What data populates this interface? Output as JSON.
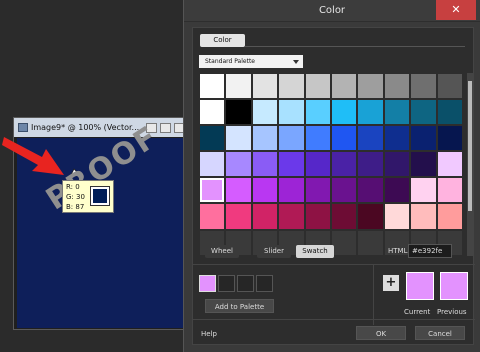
{
  "document_window": {
    "title": "Image9* @ 100% (Vector...",
    "watermark": "PROOF",
    "readout": {
      "r": "R: 0",
      "g": "G: 30",
      "b": "B: 87"
    },
    "sample_color": "#001e57"
  },
  "dialog": {
    "title": "Color",
    "close_icon": "close-icon",
    "tab_label": "Color",
    "palette_select": "Standard Palette",
    "palette_colors": [
      [
        "#ffffff",
        "#f2f2f2",
        "#e3e3e3",
        "#d5d5d5",
        "#c6c6c6",
        "#b3b3b3",
        "#9e9e9e",
        "#8a8a8a",
        "#6f6f6f",
        "#555555"
      ],
      [
        "#ffffff",
        "#000000",
        "#c6eaff",
        "#a8e1ff",
        "#59cfff",
        "#1fbef7",
        "#19a2d6",
        "#137fa6",
        "#0e6582",
        "#0a5069"
      ],
      [
        "#033a55",
        "#d4e4ff",
        "#a6c5ff",
        "#7aa6ff",
        "#407cff",
        "#1f56f2",
        "#1a44c0",
        "#0f2e8f",
        "#0a2170",
        "#06164f"
      ],
      [
        "#d6d6ff",
        "#a788ff",
        "#8a5cf5",
        "#6b39ea",
        "#5627c9",
        "#4a22a6",
        "#3e1d88",
        "#31176a",
        "#230f4c",
        "#f1c9ff"
      ],
      [
        "#e392fe",
        "#d55cff",
        "#b937f2",
        "#9d24d6",
        "#8118b0",
        "#6a128f",
        "#560e73",
        "#3d0a53",
        "#ffd2f0",
        "#ffb3df"
      ],
      [
        "#ff6f9e",
        "#f03a7f",
        "#d12366",
        "#b01a55",
        "#8e1244",
        "#6d0c34",
        "#4b0722",
        "#ffd9d9",
        "#ffbcbc",
        "#ff9c9c"
      ],
      [
        "#3a3a3a",
        "#3a3a3a",
        "#3a3a3a",
        "#3a3a3a",
        "#3a3a3a",
        "#3a3a3a",
        "#3a3a3a",
        "#3a3a3a",
        "#3a3a3a",
        "#3a3a3a"
      ]
    ],
    "selected_cell": [
      4,
      0
    ],
    "modes": {
      "wheel": "Wheel",
      "slider": "Slider",
      "swatch": "Swatch"
    },
    "html_label": "HTML",
    "html_value": "#e392fe",
    "recent_colors": [
      "#e392fe",
      "",
      "",
      ""
    ],
    "add_to_palette": "Add to Palette",
    "plus_label": "+",
    "current_label": "Current",
    "previous_label": "Previous",
    "current_color": "#e392fe",
    "previous_color": "#e392fe",
    "help_label": "Help",
    "ok_label": "OK",
    "cancel_label": "Cancel"
  }
}
